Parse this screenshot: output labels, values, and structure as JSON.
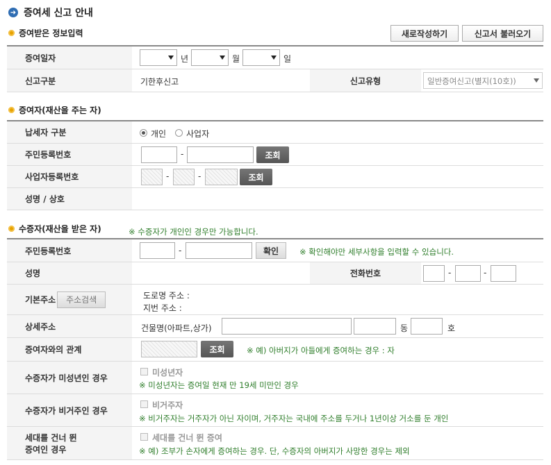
{
  "page": {
    "title": "증여세 신고 안내",
    "title_icon": "arrow-right-circle-icon"
  },
  "buttons": {
    "new_write": "새로작성하기",
    "load_return": "신고서 불러오기"
  },
  "section1": {
    "title": "증여받은 정보입력",
    "gift_date_label": "증여일자",
    "year_unit": "년",
    "month_unit": "월",
    "day_unit": "일",
    "report_type_label": "신고구분",
    "report_type_value": "기한후신고",
    "report_kind_label": "신고유형",
    "report_kind_value": "일반증여신고(별지(10호))"
  },
  "section2": {
    "title": "증여자(재산을 주는 자)",
    "taxpayer_type_label": "납세자 구분",
    "opt_individual": "개인",
    "opt_business": "사업자",
    "resident_no_label": "주민등록번호",
    "business_no_label": "사업자등록번호",
    "name_label": "성명 / 상호",
    "lookup": "조회",
    "dash": "-"
  },
  "section3": {
    "title": "수증자(재산을 받은 자)",
    "title_notice": "※ 수증자가 개인인 경우만 가능합니다.",
    "resident_no_label": "주민등록번호",
    "confirm": "확인",
    "confirm_notice": "※ 확인해야만 세부사항을 입력할 수 있습니다.",
    "name_label": "성명",
    "phone_label": "전화번호",
    "address_label": "기본주소",
    "address_search": "주소검색",
    "road_address": "도로명 주소 :",
    "lot_address": "지번 주소 :",
    "detail_label": "상세주소",
    "building_name": "건물명(아파트,상가)",
    "dong": "동",
    "ho": "호",
    "relation_label": "증여자와의 관계",
    "lookup": "조회",
    "relation_notice": "※ 예) 아버지가 아들에게 증여하는 경우 : 자",
    "minor_label": "수증자가 미성년인 경우",
    "minor_check": "미성년자",
    "minor_notice": "※ 미성년자는 증여일 현재 만 19세 미만인 경우",
    "nonres_label": "수증자가 비거주인 경우",
    "nonres_check": "비거주자",
    "nonres_notice": "※ 비거주자는 거주자가 아닌 자이며, 거주자는 국내에 주소를 두거나 1년이상 거소를 둔 개인",
    "skip_label_1": "세대를 건너 뛴",
    "skip_label_2": "증여인 경우",
    "skip_check": "세대를 건너 뛴 증여",
    "skip_notice": "※ 예) 조부가 손자에게 증여하는 경우. 단, 수증자의 아버지가 사망한 경우는 제외",
    "dash": "-"
  },
  "colors": {
    "accent_blue": "#2f6db3",
    "bullet_orange": "#e8a200",
    "notice_green": "#2e7d2a",
    "dark_button": "#5e5e5e"
  }
}
